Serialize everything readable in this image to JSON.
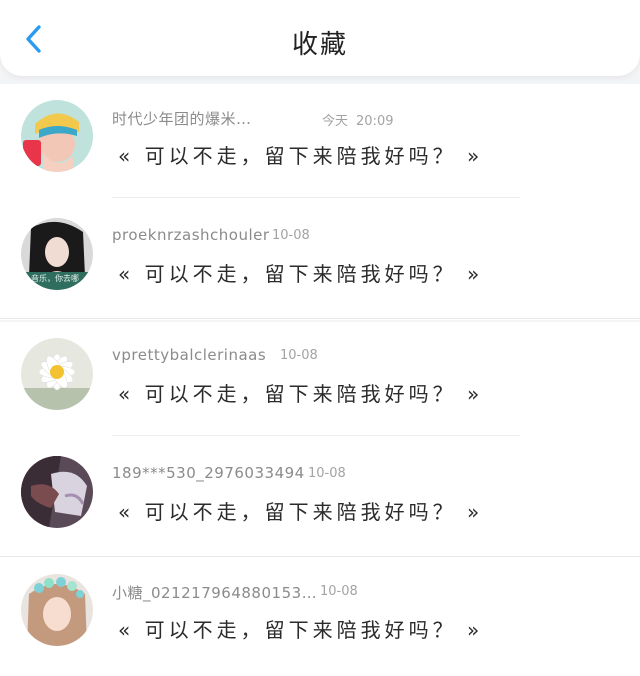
{
  "header": {
    "title": "收藏",
    "back_icon": "chevron-left-icon",
    "accent": "#2a9bf0"
  },
  "items": [
    {
      "name": "时代少年团的爆米…",
      "date": "今天",
      "clock": "20:09",
      "message": "« 可以不走，留下来陪我好吗？ »"
    },
    {
      "name": "proeknrzashchouler",
      "date": "10-08",
      "message": "« 可以不走，留下来陪我好吗？ »",
      "avatar_caption": "音乐，你去哪"
    },
    {
      "name": "vprettybalclerinaas",
      "date": "10-08",
      "message": "« 可以不走，留下来陪我好吗？ »"
    },
    {
      "name": "189***530_2976033494",
      "date": "10-08",
      "message": "« 可以不走，留下来陪我好吗？ »"
    },
    {
      "name": "小糖_021217964880153…",
      "date": "10-08",
      "message": "« 可以不走，留下来陪我好吗？ »"
    }
  ]
}
